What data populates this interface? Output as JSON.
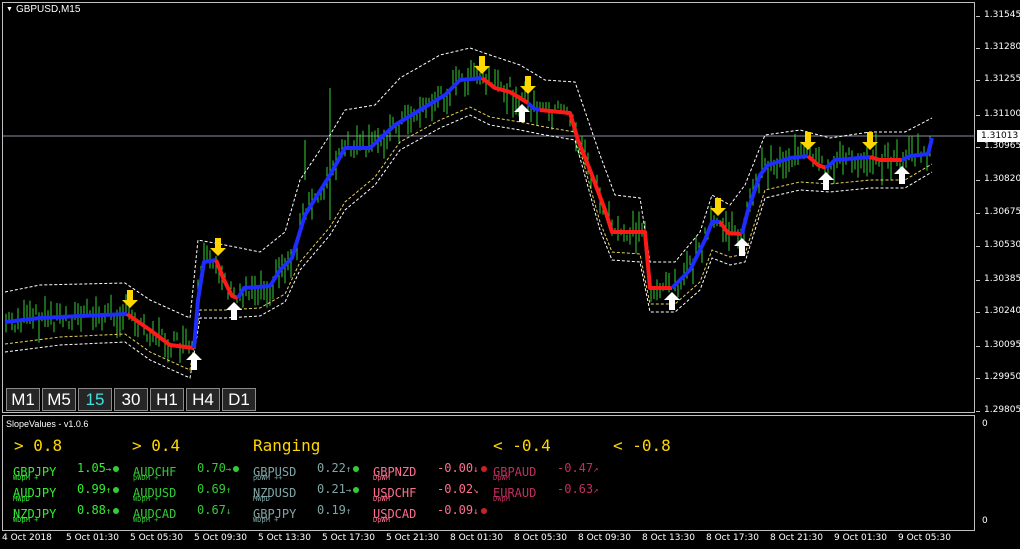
{
  "chart": {
    "title": "GBPUSD,M15",
    "current_price": "1.31013",
    "price_labels": [
      "1.31545",
      "1.31280",
      "1.31255",
      "1.31100",
      "1.30965",
      "1.30820",
      "1.30675",
      "1.30530",
      "1.30385",
      "1.30240",
      "1.30095",
      "1.29950",
      "1.29805"
    ],
    "time_labels": [
      "4 Oct 2018",
      "5 Oct 01:30",
      "5 Oct 05:30",
      "5 Oct 09:30",
      "5 Oct 13:30",
      "5 Oct 17:30",
      "5 Oct 21:30",
      "8 Oct 01:30",
      "8 Oct 05:30",
      "8 Oct 09:30",
      "8 Oct 13:30",
      "8 Oct 17:30",
      "8 Oct 21:30",
      "9 Oct 01:30",
      "9 Oct 05:30"
    ],
    "colors": {
      "up": "#1e2cff",
      "down": "#ff1a1a",
      "candles": "#33cc33",
      "band": "#ffffff",
      "band2": "#e6d35a",
      "sell_arrow": "#ffd700",
      "buy_arrow": "#ffffff"
    }
  },
  "timeframes": [
    {
      "label": "M1",
      "active": false
    },
    {
      "label": "M5",
      "active": false
    },
    {
      "label": "15",
      "active": true
    },
    {
      "label": "30",
      "active": false
    },
    {
      "label": "H1",
      "active": false
    },
    {
      "label": "H4",
      "active": false
    },
    {
      "label": "D1",
      "active": false
    }
  ],
  "subwindow": {
    "title": "SlopeValues - v1.0.6",
    "axis_top": "0",
    "axis_bottom": "0",
    "headers": [
      "> 0.8",
      "> 0.4",
      "Ranging",
      "< -0.4",
      "< -0.8"
    ],
    "columns": [
      {
        "color": "#33ee33",
        "rows": [
          {
            "pair": "GBPJPY",
            "value": "1.05",
            "arrow": "→",
            "sub": "WDpM +",
            "dot": "#33cc33"
          },
          {
            "pair": "AUDJPY",
            "value": "0.99",
            "arrow": "↑",
            "sub": "MWpD",
            "dot": "#33cc33"
          },
          {
            "pair": "NZDJPY",
            "value": "0.88",
            "arrow": "↑",
            "sub": "WDpM +",
            "dot": "#33cc33"
          }
        ]
      },
      {
        "color": "#33cc33",
        "rows": [
          {
            "pair": "AUDCHF",
            "value": "0.70",
            "arrow": "→",
            "sub": "pWDM +",
            "dot": "#33cc33"
          },
          {
            "pair": "AUDUSD",
            "value": "0.69",
            "arrow": "↑",
            "sub": "WDpM +",
            "dot": ""
          },
          {
            "pair": "AUDCAD",
            "value": "0.67",
            "arrow": "↓",
            "sub": "WDpM +",
            "dot": ""
          }
        ]
      },
      {
        "color": "#7fa6a6",
        "rows": [
          {
            "pair": "GBPUSD",
            "value": "0.22",
            "arrow": "↑",
            "sub": "pDWM ++",
            "dot": "#33cc33"
          },
          {
            "pair": "NZDUSD",
            "value": "0.21",
            "arrow": "→",
            "sub": "MWpD",
            "dot": "#33cc33"
          },
          {
            "pair": "GBPJPY",
            "value": "0.19",
            "arrow": "↑",
            "sub": "WDpM +",
            "dot": ""
          }
        ]
      },
      {
        "color": "#ff6f8f",
        "rows": [
          {
            "pair": "GBPNZD",
            "value": "-0.00",
            "arrow": "↓",
            "sub": "DpWM",
            "dot": "#cc2222"
          },
          {
            "pair": "USDCHF",
            "value": "-0.02",
            "arrow": "↘",
            "sub": "DpWM",
            "dot": ""
          },
          {
            "pair": "USDCAD",
            "value": "-0.09",
            "arrow": "↓",
            "sub": "DpWM",
            "dot": "#cc2222"
          }
        ]
      },
      {
        "color": "#c02f5f",
        "rows": [
          {
            "pair": "GBPAUD",
            "value": "-0.47",
            "arrow": "↗",
            "sub": "DpWM",
            "dot": ""
          },
          {
            "pair": "EURAUD",
            "value": "-0.63",
            "arrow": "↗",
            "sub": "DWpM",
            "dot": ""
          }
        ]
      }
    ]
  }
}
